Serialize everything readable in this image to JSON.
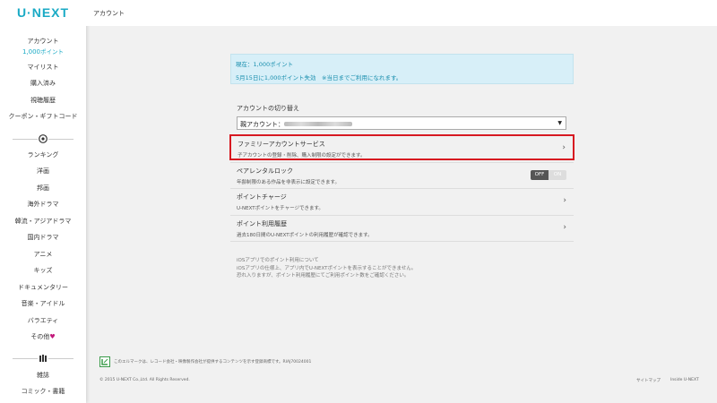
{
  "sidebar": {
    "logo": "U·NEXT",
    "account": {
      "label": "アカウント",
      "points": "1,000",
      "points_unit": "ポイント"
    },
    "top_items": [
      "マイリスト",
      "購入済み",
      "視聴履歴",
      "クーポン・ギフトコード"
    ],
    "video_items": [
      "ランキング",
      "洋画",
      "邦画",
      "海外ドラマ",
      "韓流・アジアドラマ",
      "国内ドラマ",
      "アニメ",
      "キッズ",
      "ドキュメンタリー",
      "音楽・アイドル",
      "バラエティ",
      "その他"
    ],
    "book_items": [
      "雑誌",
      "コミック・書籍"
    ]
  },
  "header": {
    "title": "アカウント"
  },
  "notice": {
    "current_points": "現在：1,000ポイント",
    "expiry": "5月15日に1,000ポイント失効　※当日までご利用になれます。"
  },
  "account_switch": {
    "title": "アカウントの切り替え",
    "select_label": "親アカウント："
  },
  "rows": [
    {
      "title": "ファミリーアカウントサービス",
      "desc": "子アカウントの登録・削除、購入制限の設定ができます。"
    },
    {
      "title": "ペアレンタルロック",
      "desc": "年齢制限のある作品を非表示に設定できます。",
      "toggle_off": "OFF",
      "toggle_on": "ON"
    },
    {
      "title": "ポイントチャージ",
      "desc": "U-NEXTポイントをチャージできます。"
    },
    {
      "title": "ポイント利用履歴",
      "desc": "過去180日間のU-NEXTポイントの利用履歴が確認できます。"
    }
  ],
  "ios_note": [
    "iOSアプリでのポイント利用について",
    "iOSアプリの仕様上、アプリ内でU-NEXTポイントを表示することができません。",
    "恐れ入りますが、ポイント利用履歴にてご利用ポイント数をご確認ください。"
  ],
  "footer": {
    "note": "このエルマークは、レコード会社・映像製作会社が提供するコンテンツを示す登録商標です。RIAJ70024001",
    "copyright": "© 2015 U-NEXT Co.,Ltd. All Rights Reserved.",
    "sitemap": "サイトマップ",
    "inside": "Inside U-NEXT"
  },
  "colors": {
    "brand": "#1aaac5",
    "highlight": "#d71921",
    "heart": "#c2187a"
  }
}
